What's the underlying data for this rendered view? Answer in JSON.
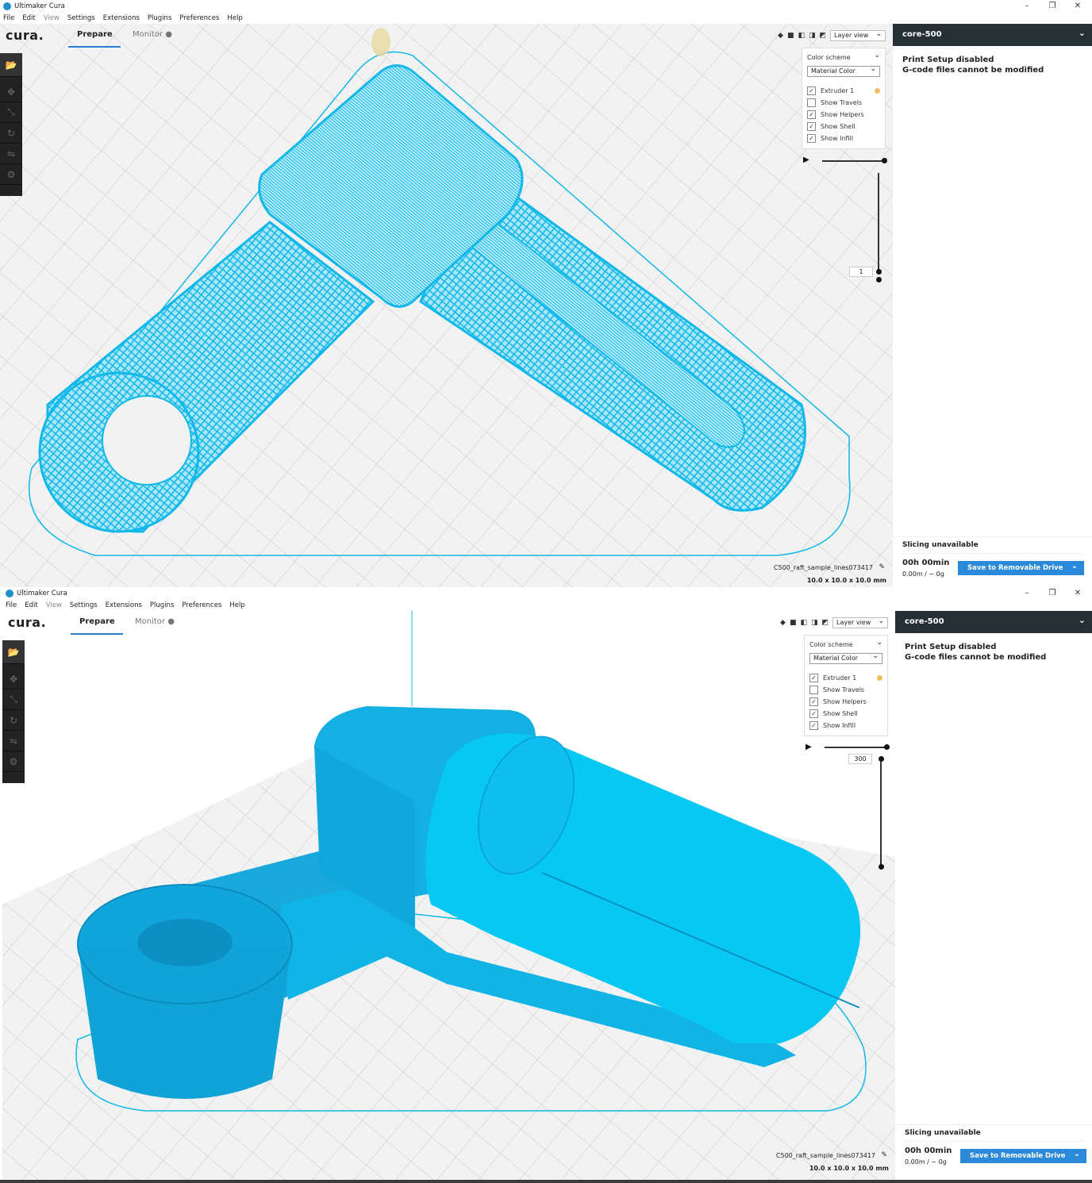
{
  "window_title": "Ultimaker Cura",
  "menu": [
    "File",
    "Edit",
    "View",
    "Settings",
    "Extensions",
    "Plugins",
    "Preferences",
    "Help"
  ],
  "logo": "cura.",
  "tabs": {
    "prepare": "Prepare",
    "monitor": "Monitor"
  },
  "view_select": "Layer view",
  "panel": {
    "color_scheme": "Color scheme",
    "material": "Material Color",
    "extruder": "Extruder 1",
    "show_travels": "Show Travels",
    "show_helpers": "Show Helpers",
    "show_shell": "Show Shell",
    "show_infill": "Show Infill"
  },
  "layer_top": {
    "value": "1"
  },
  "layer_bottom": {
    "value": "300"
  },
  "printer": "core-500",
  "setup": {
    "line1": "Print Setup disabled",
    "line2": "G-code files cannot be modified"
  },
  "slicing": {
    "title": "Slicing unavailable",
    "time": "00h 00min",
    "material": "0.00m / ~ 0g",
    "save": "Save to Removable Drive"
  },
  "file": {
    "name": "C500_raft_sample_lines073417",
    "dims": "10.0 x 10.0 x 10.0 mm"
  },
  "colors": {
    "model": "#12b8e8",
    "accent": "#2a8ad9",
    "header": "#263034"
  }
}
